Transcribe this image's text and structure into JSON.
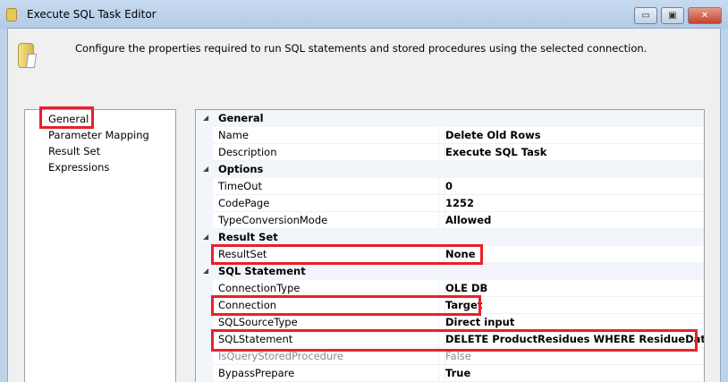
{
  "window": {
    "title": "Execute SQL Task Editor",
    "minimize": "▭",
    "maximize": "▣",
    "close": "✕"
  },
  "header": {
    "description": "Configure the properties required to run SQL statements and stored procedures using the selected connection."
  },
  "nav": {
    "items": [
      {
        "label": "General",
        "selected": true
      },
      {
        "label": "Parameter Mapping"
      },
      {
        "label": "Result Set"
      },
      {
        "label": "Expressions"
      }
    ]
  },
  "grid": {
    "rows": [
      {
        "type": "category",
        "name": "General"
      },
      {
        "type": "property",
        "name": "Name",
        "value": "Delete Old Rows"
      },
      {
        "type": "property",
        "name": "Description",
        "value": "Execute SQL Task"
      },
      {
        "type": "category",
        "name": "Options"
      },
      {
        "type": "property",
        "name": "TimeOut",
        "value": "0"
      },
      {
        "type": "property",
        "name": "CodePage",
        "value": "1252"
      },
      {
        "type": "property",
        "name": "TypeConversionMode",
        "value": "Allowed"
      },
      {
        "type": "category",
        "name": "Result Set"
      },
      {
        "type": "property",
        "name": "ResultSet",
        "value": "None"
      },
      {
        "type": "category",
        "name": "SQL Statement"
      },
      {
        "type": "property",
        "name": "ConnectionType",
        "value": "OLE DB"
      },
      {
        "type": "property",
        "name": "Connection",
        "value": "Target"
      },
      {
        "type": "property",
        "name": "SQLSourceType",
        "value": "Direct input"
      },
      {
        "type": "property",
        "name": "SQLStatement",
        "value": "DELETE ProductResidues WHERE ResidueDate>=?"
      },
      {
        "type": "property",
        "name": "IsQueryStoredProcedure",
        "value": "False",
        "disabled": true
      },
      {
        "type": "property",
        "name": "BypassPrepare",
        "value": "True"
      }
    ]
  },
  "highlight_color": "#e8202a"
}
